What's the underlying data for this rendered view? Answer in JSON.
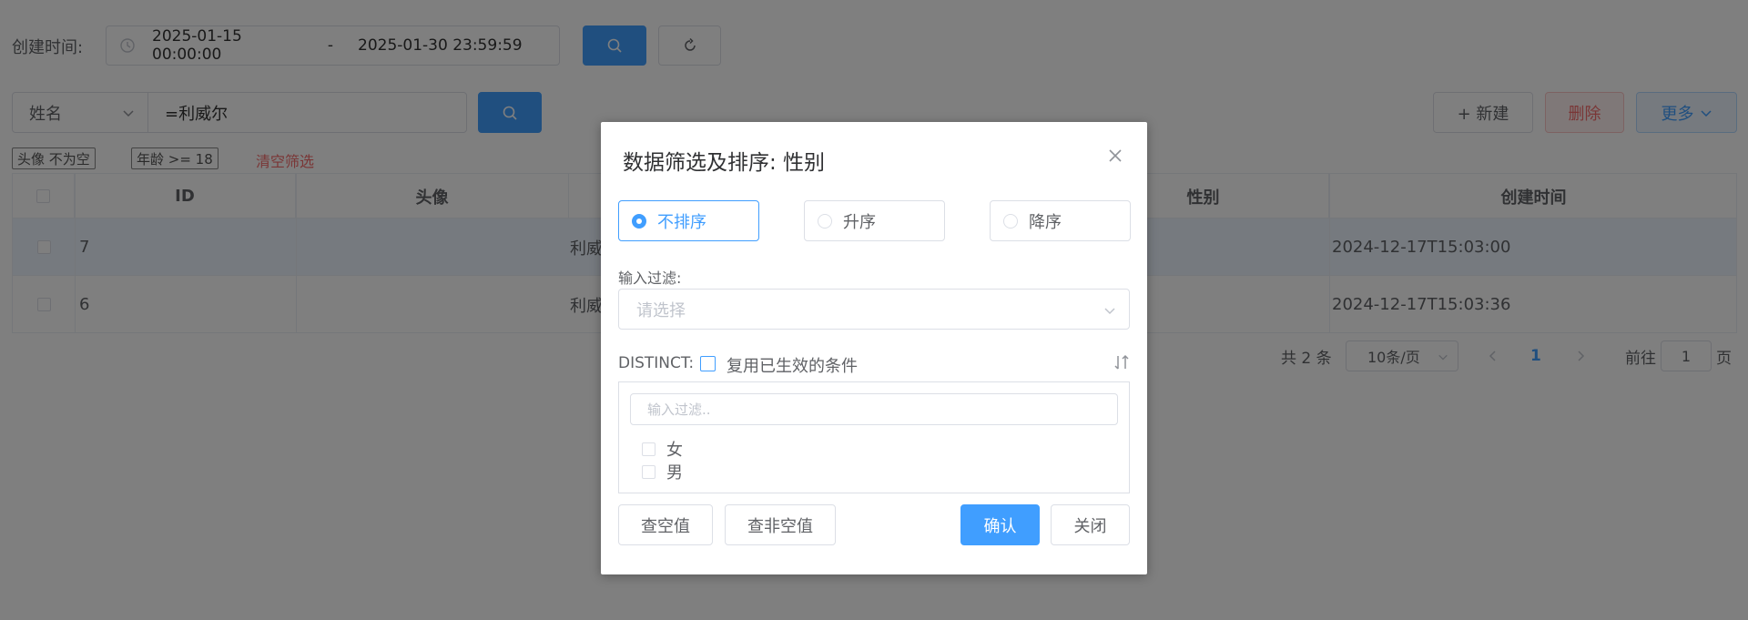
{
  "filter_bar": {
    "created_label": "创建时间:",
    "date_start": "2025-01-15 00:00:00",
    "date_separator": "-",
    "date_end": "2025-01-30 23:59:59"
  },
  "search_bar": {
    "field": "姓名",
    "value": "=利威尔"
  },
  "toolbar": {
    "new_label": "+ 新建",
    "delete_label": "删除",
    "more_label": "更多"
  },
  "active_filters": {
    "tags": [
      "头像 不为空",
      "年龄 >= 18"
    ],
    "clear_label": "清空筛选"
  },
  "table": {
    "headers": [
      "ID",
      "头像",
      "性别",
      "创建时间"
    ],
    "rows": [
      {
        "id": "7",
        "name": "利威",
        "created": "2024-12-17T15:03:00"
      },
      {
        "id": "6",
        "name": "利威",
        "created": "2024-12-17T15:03:36"
      }
    ]
  },
  "pagination": {
    "total": "共 2 条",
    "page_size": "10条/页",
    "current_page": "1",
    "goto_label": "前往",
    "goto_value": "1",
    "page_suffix": "页"
  },
  "dialog": {
    "title": "数据筛选及排序: 性别",
    "sort_options": [
      "不排序",
      "升序",
      "降序"
    ],
    "selected_sort": "不排序",
    "filter_label": "输入过滤:",
    "filter_placeholder": "请选择",
    "distinct_label": "DISTINCT:",
    "reuse_label": "复用已生效的条件",
    "list_filter_placeholder": "输入过滤..",
    "values": [
      "女",
      "男"
    ],
    "null_button": "查空值",
    "not_null_button": "查非空值",
    "confirm_button": "确认",
    "close_button": "关闭"
  },
  "colors": {
    "primary": "#409eff",
    "danger": "#f56c6c",
    "overlay": "rgba(0,0,0,0.5)"
  }
}
